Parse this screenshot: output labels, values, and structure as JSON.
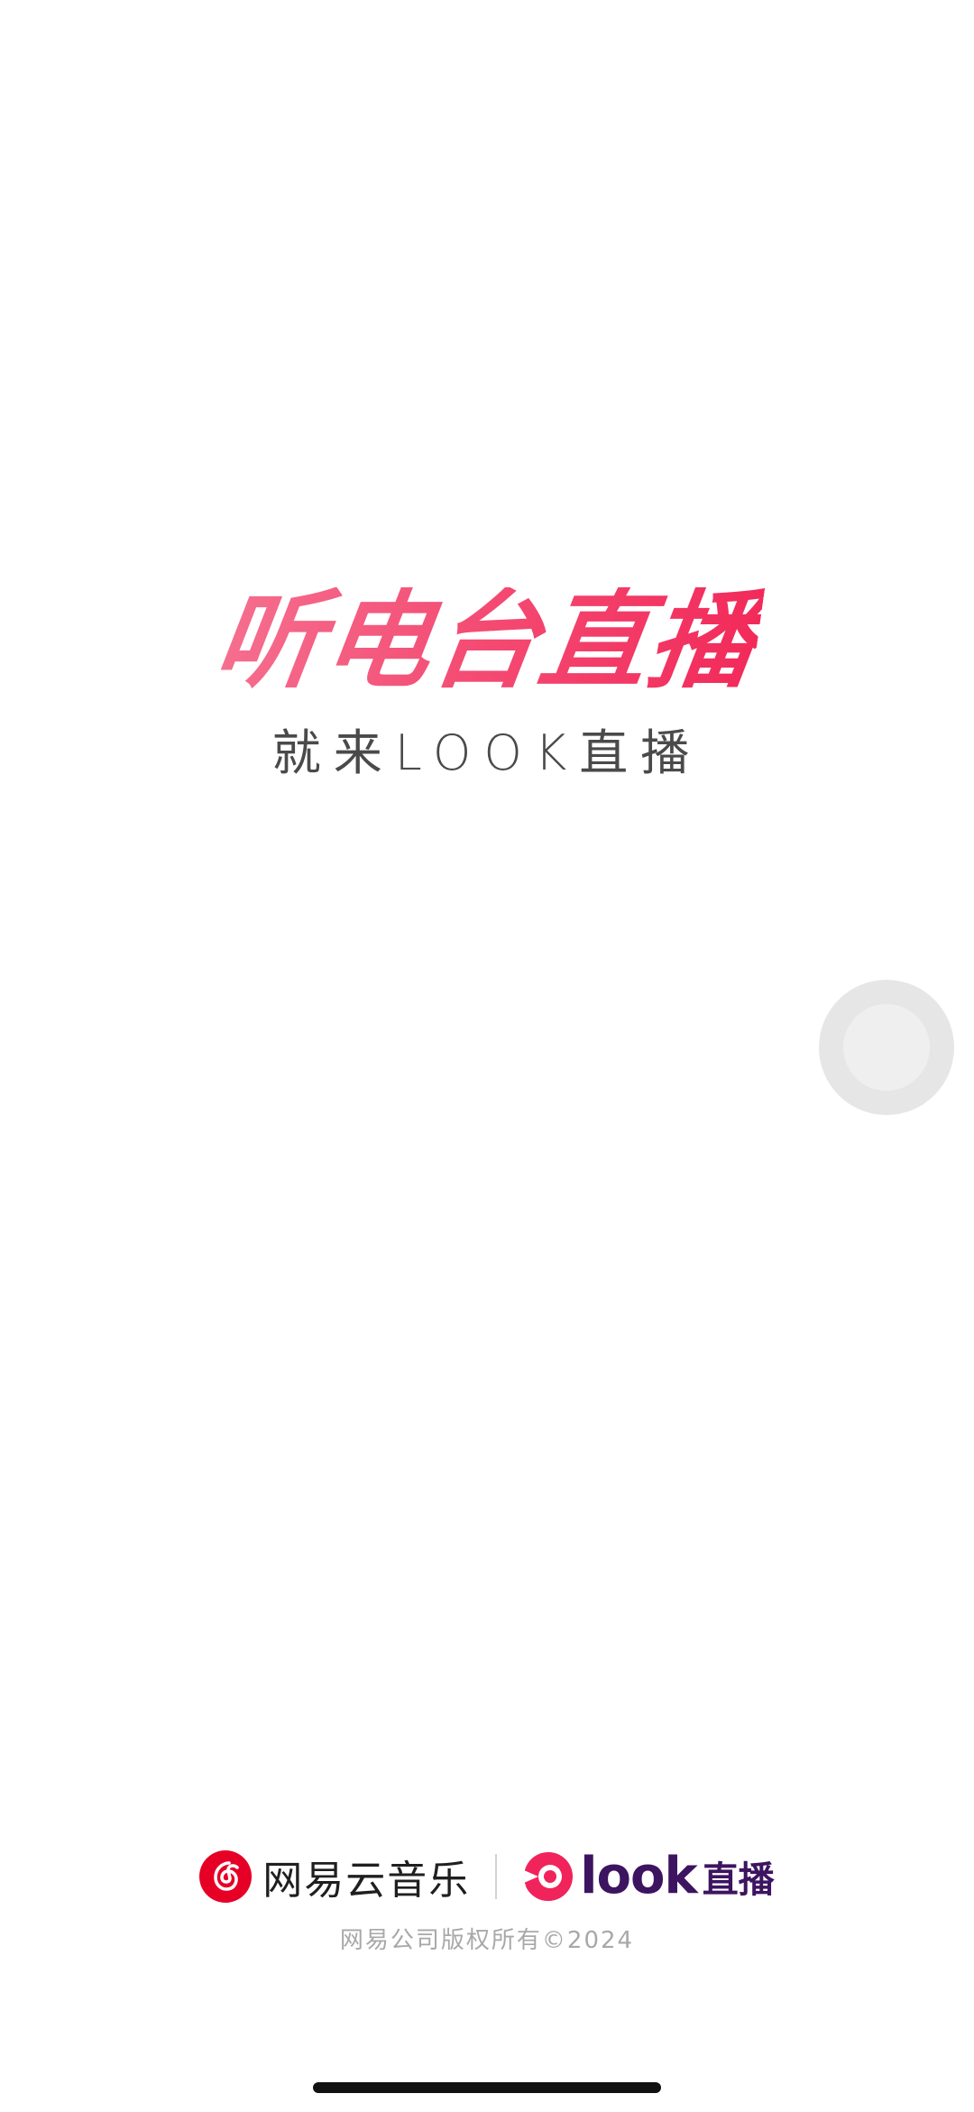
{
  "splash": {
    "slogan_main": "听电台直播",
    "slogan_sub": "就来LOOK直播"
  },
  "brand": {
    "netease_name": "网易云音乐",
    "look_text": "look",
    "look_zhibo": "直播",
    "copyright": "网易公司版权所有©2024"
  },
  "colors": {
    "slogan_gradient_start": "#f56f8f",
    "slogan_gradient_end": "#f22a5a",
    "netease_red": "#e60026",
    "look_red": "#f0245a",
    "look_purple": "#3d1460"
  },
  "icons": {
    "netease_logo": "netease-music-icon",
    "look_logo": "look-logo-icon",
    "floating_button": "assistive-touch-icon"
  }
}
